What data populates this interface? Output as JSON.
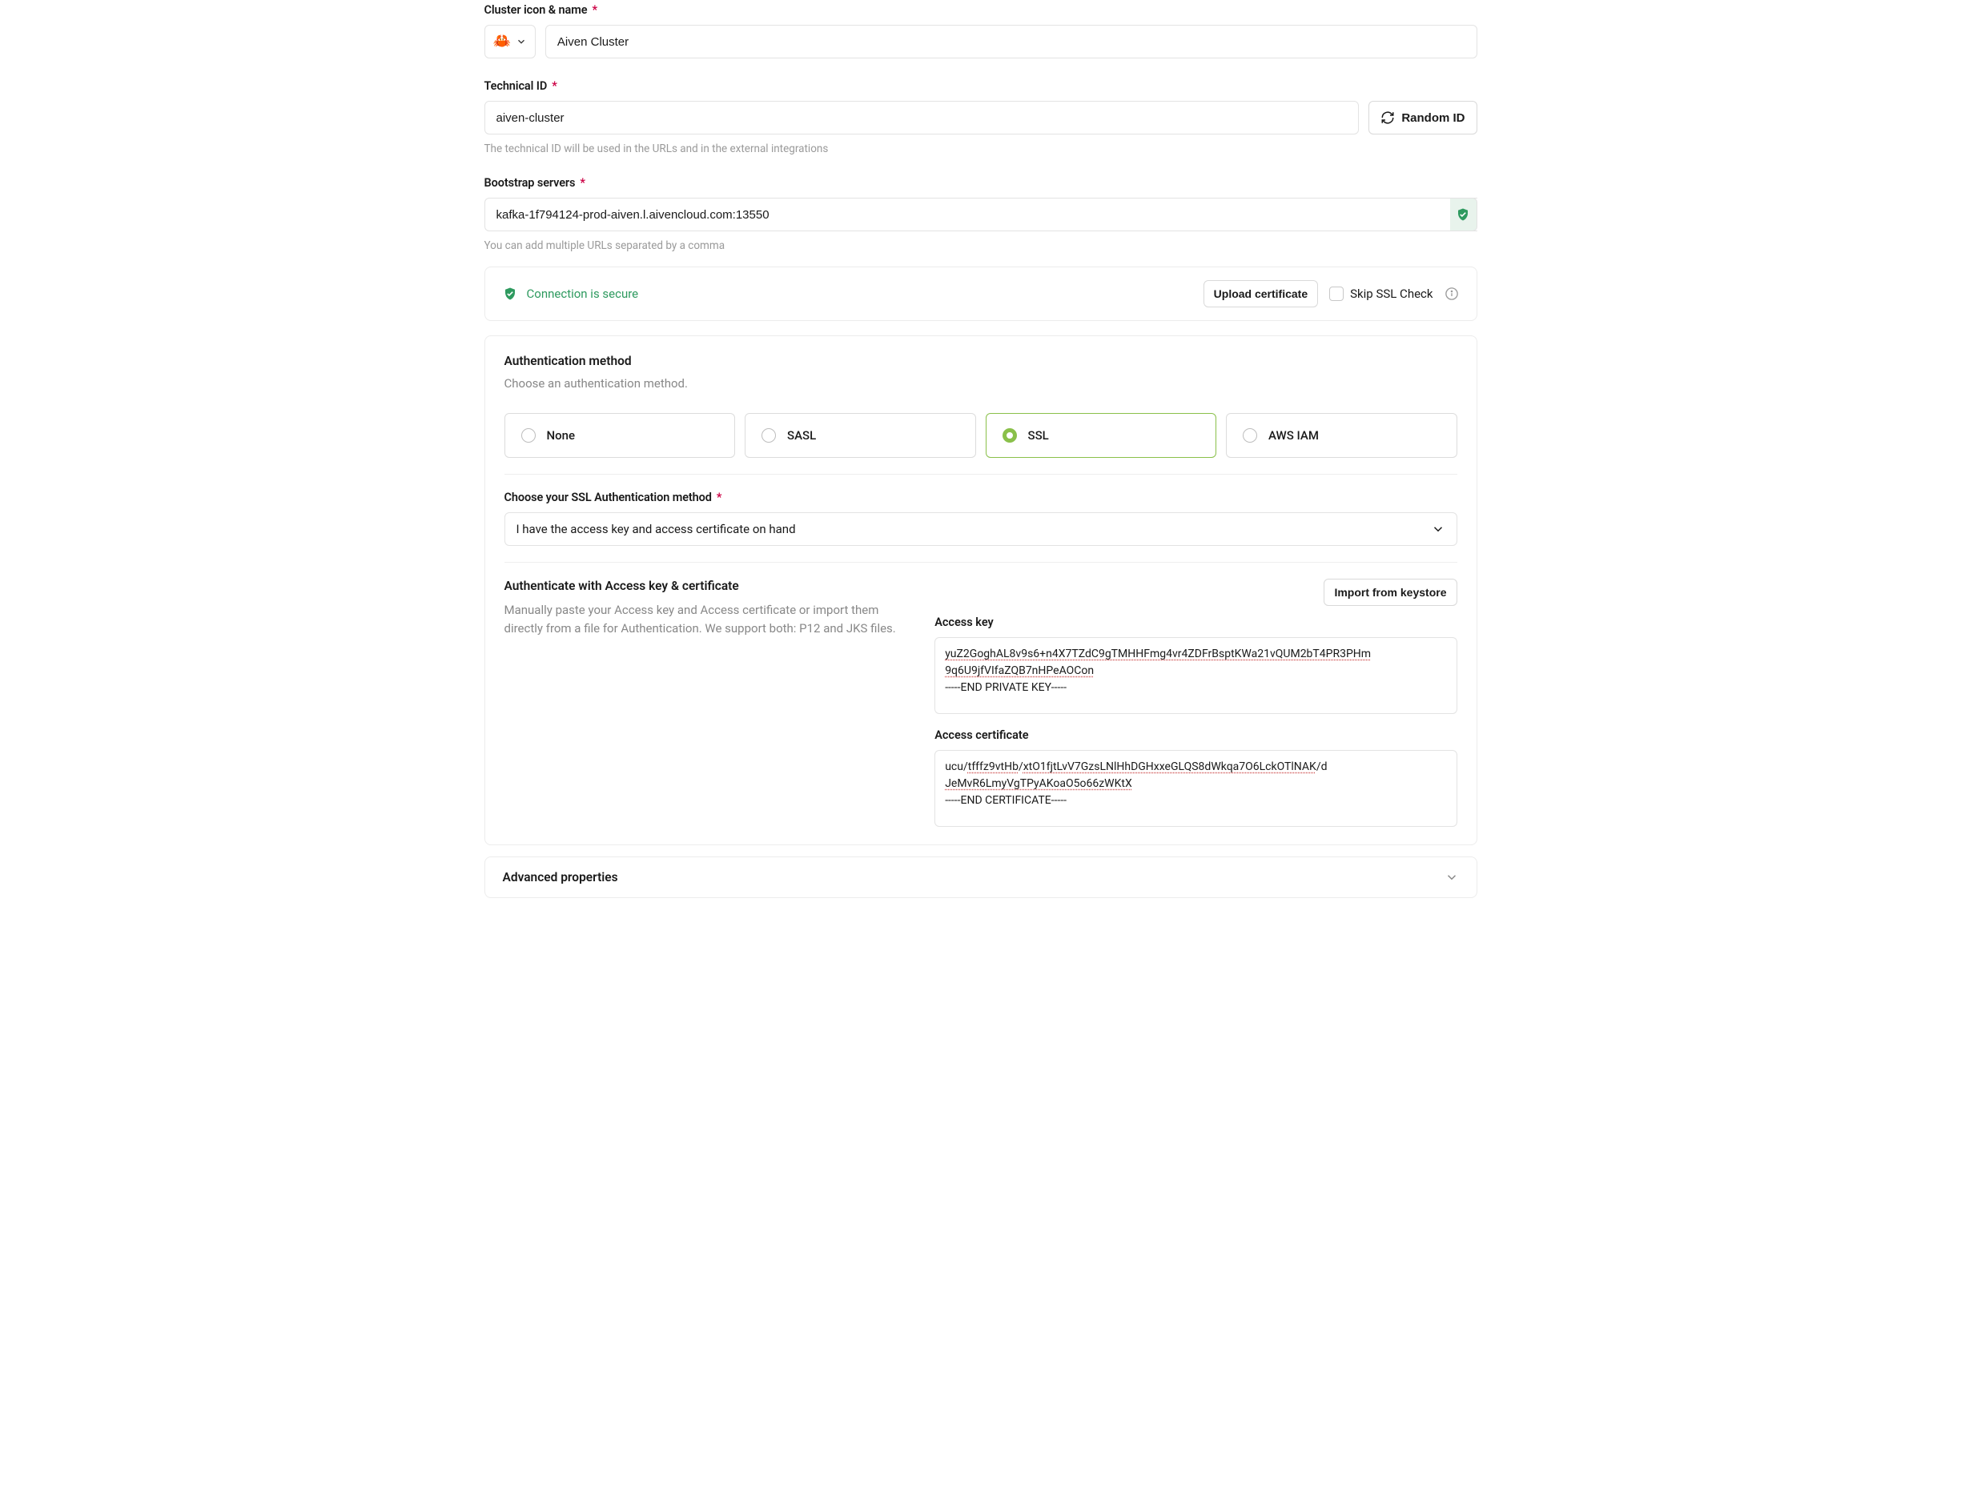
{
  "cluster": {
    "label": "Cluster icon & name",
    "icon_emoji": "🦀",
    "name_value": "Aiven Cluster"
  },
  "technical_id": {
    "label": "Technical ID",
    "value": "aiven-cluster",
    "help": "The technical ID will be used in the URLs and in the external integrations",
    "random_btn": "Random ID"
  },
  "bootstrap": {
    "label": "Bootstrap servers",
    "value": "kafka-1f794124-prod-aiven.l.aivencloud.com:13550",
    "help": "You can add multiple URLs separated by a comma"
  },
  "connection": {
    "status_text": "Connection is secure",
    "upload_btn": "Upload certificate",
    "skip_label": "Skip SSL Check"
  },
  "auth": {
    "title": "Authentication method",
    "subtitle": "Choose an authentication method.",
    "options": {
      "none": "None",
      "sasl": "SASL",
      "ssl": "SSL",
      "aws": "AWS IAM"
    }
  },
  "ssl_method": {
    "label": "Choose your SSL Authentication method",
    "value": "I have the access key and access certificate on hand"
  },
  "access": {
    "title": "Authenticate with Access key & certificate",
    "description": "Manually paste your Access key and Access certificate or import them directly from a file for Authentication. We support both: P12 and JKS files.",
    "import_btn": "Import from keystore",
    "key_label": "Access key",
    "key_line1": "yuZ2GoghAL8v9s6+n4X7TZdC9gTMHHFmg4vr4ZDFrBsptKWa21vQUM2bT4PR3PHm",
    "key_line2": "9q6U9jfVIfaZQB7nHPeAOCon",
    "key_line3": "-----END PRIVATE KEY-----",
    "cert_label": "Access certificate",
    "cert_pre": "ucu/",
    "cert_mid1": "tfffz9vtHb",
    "cert_slash": "/",
    "cert_mid2": "xtO1fjtLvV7GzsLNlHhDGHxxeGLQS8dWkqa7O6LckOTlNAK",
    "cert_post": "/d",
    "cert_line2": "JeMvR6LmyVgTPyAKoaO5o66zWKtX",
    "cert_line3": "-----END CERTIFICATE-----"
  },
  "advanced": {
    "title": "Advanced properties"
  }
}
